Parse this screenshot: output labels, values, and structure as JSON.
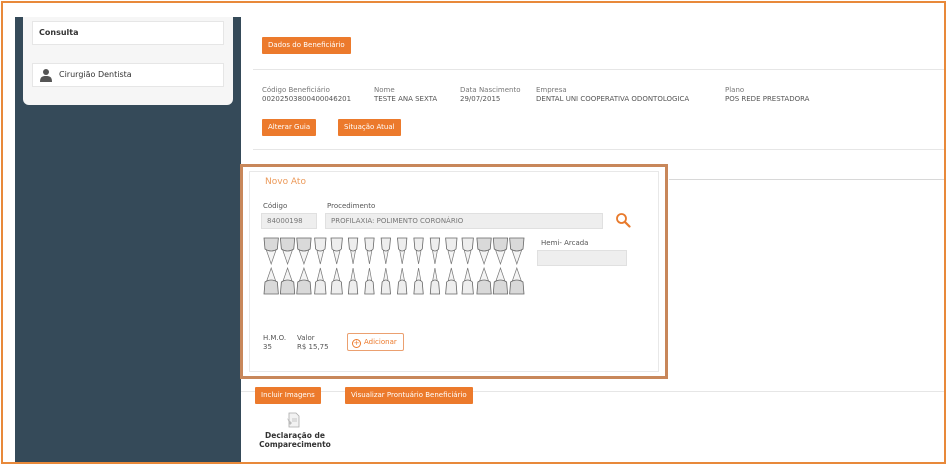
{
  "sidebar": {
    "consulta": "Consulta",
    "cirurgiao": "Cirurgião Dentista"
  },
  "header": {
    "dados_btn": "Dados do Beneficiário"
  },
  "beneficiario": {
    "codigo_label": "Código Beneficiário",
    "codigo_value": "00202503800400046201",
    "nome_label": "Nome",
    "nome_value": "TESTE ANA SEXTA",
    "nascimento_label": "Data Nascimento",
    "nascimento_value": "29/07/2015",
    "empresa_label": "Empresa",
    "empresa_value": "DENTAL UNI COOPERATIVA ODONTOLOGICA",
    "plano_label": "Plano",
    "plano_value": "POS REDE PRESTADORA"
  },
  "actions": {
    "alterar_guia": "Alterar Guia",
    "situacao_atual": "Situação Atual"
  },
  "novo_ato": {
    "title": "Novo Ato",
    "codigo_label": "Código",
    "codigo_value": "84000198",
    "procedimento_label": "Procedimento",
    "procedimento_value": "PROFILAXIA: POLIMENTO CORONÁRIO",
    "hemi_label": "Hemi- Arcada",
    "hmo_label": "H.M.O.",
    "hmo_value": "35",
    "valor_label": "Valor",
    "valor_value": "R$ 15,75",
    "adicionar": "Adicionar"
  },
  "bottom": {
    "incluir_imagens": "Incluir Imagens",
    "visualizar_prontuario": "Visualizar Prontuário Beneficiário",
    "declaracao_line1": "Declaração de",
    "declaracao_line2": "Comparecimento"
  },
  "colors": {
    "accent": "#ec7a2c",
    "sidebar": "#354a59",
    "frame": "#e8893a"
  }
}
